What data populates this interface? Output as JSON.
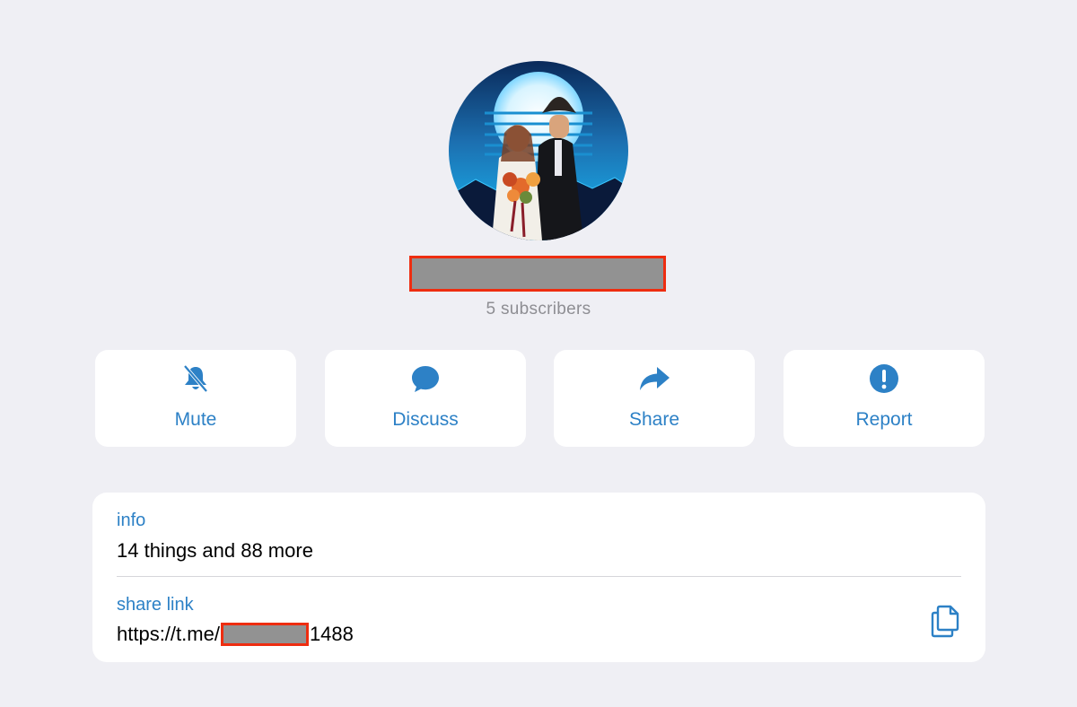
{
  "header": {
    "subscribers": "5 subscribers"
  },
  "actions": [
    {
      "label": "Mute",
      "icon": "bell-slash-icon"
    },
    {
      "label": "Discuss",
      "icon": "chat-bubble-icon"
    },
    {
      "label": "Share",
      "icon": "share-arrow-icon"
    },
    {
      "label": "Report",
      "icon": "exclamation-circle-icon"
    }
  ],
  "info": {
    "title": "info",
    "value": "14 things and 88 more"
  },
  "share_link": {
    "title": "share link",
    "prefix": "https://t.me/",
    "suffix": "1488",
    "copy_icon": "copy-icon"
  },
  "colors": {
    "accent": "#2d81c6",
    "background": "#efeff4",
    "redaction_border": "#ee2d10",
    "redaction_fill": "#929292"
  }
}
